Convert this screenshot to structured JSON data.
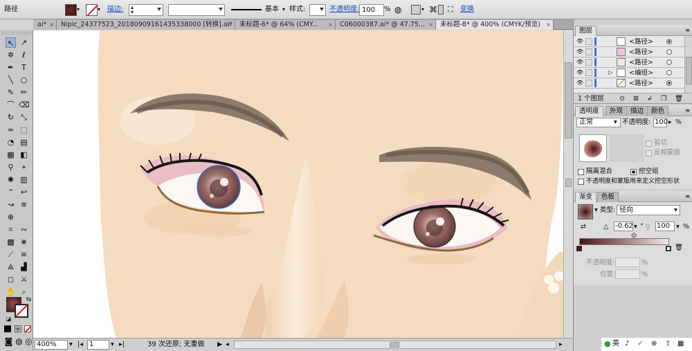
{
  "control_bar": {
    "object_type": "路径",
    "stroke_label": "描边:",
    "stroke_profile": "基本",
    "style_label": "样式:",
    "opacity_label": "不透明度:",
    "opacity_value": "100",
    "opacity_unit": "%",
    "transform_label": "变换"
  },
  "tabs": [
    {
      "label": "ai*",
      "close": "×"
    },
    {
      "label": "Nipic_24377523_20180909161435338000  [转换].ai*",
      "close": "×"
    },
    {
      "label": "未标题-6* @ 64% (CMY...",
      "close": "×"
    },
    {
      "label": "C06000387.ai* @ 47.75...",
      "close": "×"
    },
    {
      "label": "未标题-8* @ 400% (CMYK/预览)",
      "close": "×",
      "active": true
    }
  ],
  "status_bar": {
    "zoom": "400%",
    "page": "1",
    "history": "39 次还原; 无重做"
  },
  "layers_panel": {
    "tab": "图层",
    "rows": [
      {
        "name": "<路径>"
      },
      {
        "name": "<路径>"
      },
      {
        "name": "<路径>"
      },
      {
        "name": "<编组>"
      },
      {
        "name": "<路径>"
      }
    ],
    "footer": "1 个图层"
  },
  "transparency_panel": {
    "tabs": [
      "透明度",
      "外观",
      "描边",
      "颜色"
    ],
    "blend_mode": "正常",
    "opacity_label": "不透明度:",
    "opacity_value": "100",
    "opacity_unit": "%",
    "clip_label": "剪切",
    "invert_mask_label": "反相蒙版",
    "isolate_blending_label": "隔离混合",
    "knockout_group_label": "挖空组",
    "opacity_mask_label": "不透明度和蒙版用来定义挖空形状"
  },
  "gradient_panel": {
    "tabs": [
      "渐变",
      "色板"
    ],
    "type_label": "类型:",
    "type_value": "径向",
    "angle_value": "-0.62",
    "angle_unit": "°",
    "aspect_value": "100",
    "aspect_unit": "%",
    "stop_opacity_label": "不透明度:",
    "stop_location_label": "位置:",
    "stop_unit": "%",
    "gradient_start_color": "#4a1414",
    "gradient_end_color": "#f4e6e6"
  },
  "bottom_right_icons": [
    "英",
    "♪",
    "✓",
    "⊕",
    "⇧",
    "▦"
  ],
  "colors": {
    "accent": "#3f72d9",
    "skin": "#f5dcc0",
    "iris": "#7a4f4a",
    "eyeshadow": "#e8b9c4"
  }
}
